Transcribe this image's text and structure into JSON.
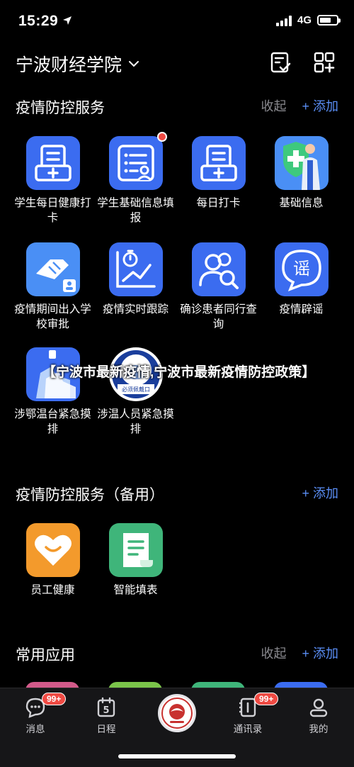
{
  "status": {
    "time": "15:29",
    "network": "4G"
  },
  "header": {
    "title": "宁波财经学院"
  },
  "section1": {
    "title": "疫情防控服务",
    "collapse": "收起",
    "add": "+ 添加",
    "items": [
      {
        "label": "学生每日健康打卡"
      },
      {
        "label": "学生基础信息填报"
      },
      {
        "label": "每日打卡"
      },
      {
        "label": "基础信息"
      },
      {
        "label": "疫情期间出入学校审批"
      },
      {
        "label": "疫情实时跟踪"
      },
      {
        "label": "确诊患者同行查询"
      },
      {
        "label": "疫情辟谣"
      },
      {
        "label": "涉鄂温台紧急摸排"
      },
      {
        "label": "涉温人员紧急摸排"
      }
    ]
  },
  "overlay_text": "【宁波市最新疫情,宁波市最新疫情防控政策】",
  "mask_sign": "必须佩戴口",
  "rumor_char": "谣",
  "section2": {
    "title": "疫情防控服务（备用）",
    "add": "+ 添加",
    "items": [
      {
        "label": "员工健康"
      },
      {
        "label": "智能填表"
      }
    ]
  },
  "section3": {
    "title": "常用应用",
    "collapse": "收起",
    "add": "+ 添加"
  },
  "tabbar": {
    "items": [
      {
        "label": "消息",
        "badge": "99+"
      },
      {
        "label": "日程",
        "day": "5"
      },
      {
        "label": ""
      },
      {
        "label": "通讯录",
        "badge": "99+"
      },
      {
        "label": "我的"
      }
    ]
  },
  "colors": {
    "blue": "#3b6cf0",
    "light_blue": "#4a8ff5",
    "orange": "#f39a2c",
    "green": "#3fb57a",
    "accent": "#5a8ef5",
    "badge": "#f04a43"
  }
}
